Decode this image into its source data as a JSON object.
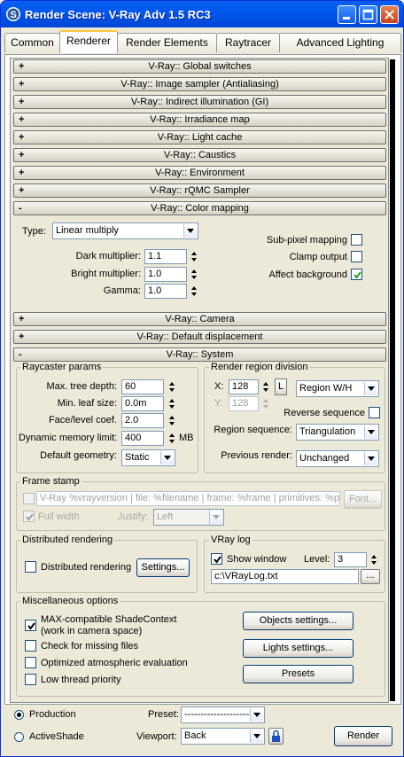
{
  "window": {
    "title": "Render Scene: V-Ray Adv 1.5 RC3",
    "title_color": "#0058ee"
  },
  "tabs": [
    {
      "label": "Common"
    },
    {
      "label": "Renderer"
    },
    {
      "label": "Render Elements"
    },
    {
      "label": "Raytracer"
    },
    {
      "label": "Advanced Lighting"
    }
  ],
  "active_tab": "Renderer",
  "rollouts": [
    {
      "sign": "+",
      "title": "V-Ray:: Global switches"
    },
    {
      "sign": "+",
      "title": "V-Ray:: Image sampler (Antialiasing)"
    },
    {
      "sign": "+",
      "title": "V-Ray:: Indirect illumination (GI)"
    },
    {
      "sign": "+",
      "title": "V-Ray:: Irradiance map"
    },
    {
      "sign": "+",
      "title": "V-Ray:: Light cache"
    },
    {
      "sign": "+",
      "title": "V-Ray:: Caustics"
    },
    {
      "sign": "+",
      "title": "V-Ray:: Environment"
    },
    {
      "sign": "+",
      "title": "V-Ray:: rQMC Sampler"
    },
    {
      "sign": "-",
      "title": "V-Ray:: Color mapping"
    },
    {
      "sign": "+",
      "title": "V-Ray:: Camera"
    },
    {
      "sign": "+",
      "title": "V-Ray:: Default displacement"
    },
    {
      "sign": "-",
      "title": "V-Ray:: System"
    }
  ],
  "color_mapping": {
    "type_label": "Type:",
    "type_value": "Linear multiply",
    "dark_label": "Dark multiplier:",
    "dark_value": "1.1",
    "bright_label": "Bright multiplier:",
    "bright_value": "1.0",
    "gamma_label": "Gamma:",
    "gamma_value": "1.0",
    "subpixel_label": "Sub-pixel mapping",
    "subpixel_checked": false,
    "clamp_label": "Clamp output",
    "clamp_checked": false,
    "affect_bg_label": "Affect background",
    "affect_bg_checked": true
  },
  "system": {
    "raycaster": {
      "title": "Raycaster params",
      "max_tree_label": "Max. tree depth:",
      "max_tree_value": "60",
      "min_leaf_label": "Min. leaf size:",
      "min_leaf_value": "0.0m",
      "face_level_label": "Face/level coef.",
      "face_level_value": "2.0",
      "dyn_mem_label": "Dynamic memory limit:",
      "dyn_mem_value": "400",
      "dyn_mem_unit": "MB",
      "default_geom_label": "Default geometry:",
      "default_geom_value": "Static"
    },
    "region": {
      "title": "Render region division",
      "x_label": "X:",
      "x_value": "128",
      "lock_label": "L",
      "y_label": "Y:",
      "y_value": "128",
      "region_mode": "Region W/H",
      "reverse_label": "Reverse sequence",
      "reverse_checked": false,
      "sequence_label": "Region sequence:",
      "sequence_value": "Triangulation",
      "prev_render_label": "Previous render:",
      "prev_render_value": "Unchanged"
    },
    "frame_stamp": {
      "title": "Frame stamp",
      "enabled": false,
      "text": "V-Ray %vrayversion | file: %filename | frame: %frame | primitives: %primitiv",
      "font_button": "Font...",
      "full_width_label": "Full width",
      "full_width_checked": true,
      "justify_label": "Justify:",
      "justify_value": "Left"
    },
    "distributed": {
      "title": "Distributed rendering",
      "checkbox_label": "Distributed rendering",
      "checked": false,
      "settings_button": "Settings..."
    },
    "vray_log": {
      "title": "VRay log",
      "show_window_label": "Show window",
      "show_window_checked": true,
      "level_label": "Level:",
      "level_value": "3",
      "path": "c:\\VRayLog.txt",
      "browse_button": "..."
    },
    "misc": {
      "title": "Miscellaneous options",
      "max_compat_label": "MAX-compatible ShadeContext",
      "max_compat_sub": "(work in camera space)",
      "max_compat_checked": true,
      "check_missing_label": "Check for missing files",
      "check_missing_checked": false,
      "optimized_atm_label": "Optimized atmospheric evaluation",
      "optimized_atm_checked": false,
      "low_thread_label": "Low thread priority",
      "low_thread_checked": false,
      "objects_button": "Objects settings...",
      "lights_button": "Lights settings...",
      "presets_button": "Presets"
    }
  },
  "bottom": {
    "production_label": "Production",
    "activeshade_label": "ActiveShade",
    "mode_selected": "Production",
    "preset_label": "Preset:",
    "preset_value": "------------------------",
    "viewport_label": "Viewport:",
    "viewport_value": "Back",
    "render_button": "Render"
  }
}
